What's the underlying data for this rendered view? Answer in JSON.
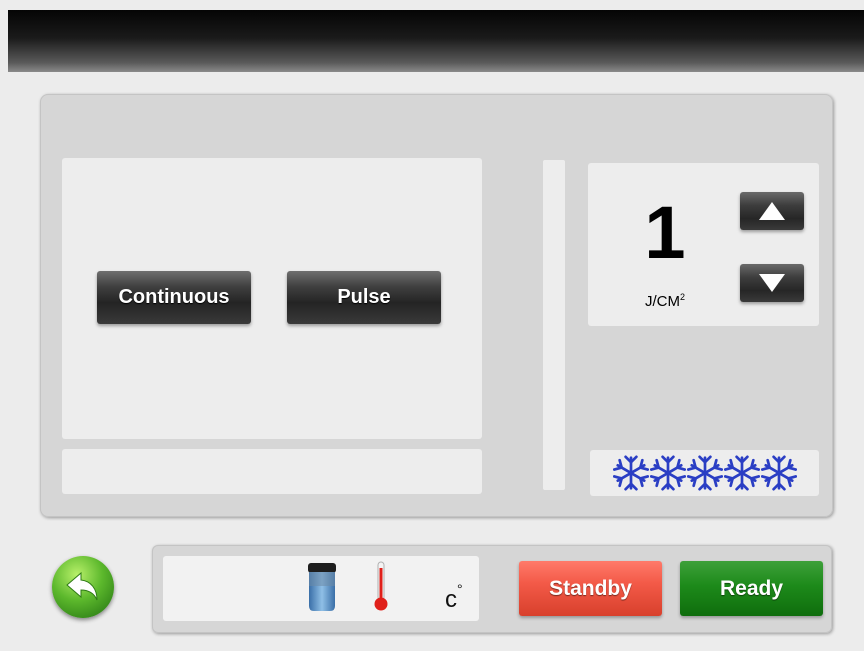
{
  "header": {},
  "modes": {
    "continuous_label": "Continuous",
    "pulse_label": "Pulse"
  },
  "energy": {
    "value": "1",
    "unit_base": "J/CM",
    "unit_sup": "2",
    "up_icon": "triangle-up-icon",
    "down_icon": "triangle-down-icon"
  },
  "cooling": {
    "icon": "snowflake-icon",
    "level": 5,
    "color": "#2a3ec4"
  },
  "status_bar": {
    "back_icon": "back-arrow-icon",
    "tank_icon": "water-tank-icon",
    "thermometer_icon": "thermometer-icon",
    "temp_unit": "c",
    "temp_unit_sup": "°",
    "standby_label": "Standby",
    "ready_label": "Ready"
  },
  "colors": {
    "standby": "#f35a48",
    "ready": "#1d8a1a",
    "back_button": "#5cb82c"
  }
}
